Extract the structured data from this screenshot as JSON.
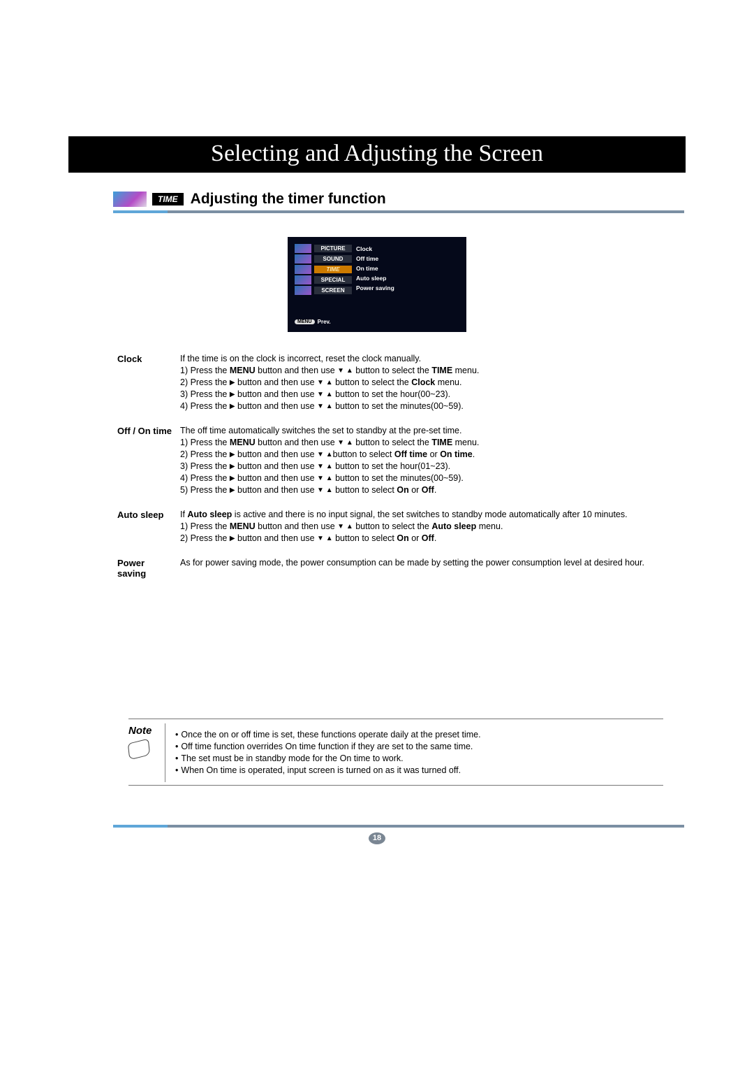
{
  "banner_title": "Selecting and Adjusting the Screen",
  "time_tag": "TIME",
  "subheading": "Adjusting the timer function",
  "osd": {
    "left": [
      "PICTURE",
      "SOUND",
      "TIME",
      "SPECIAL",
      "SCREEN"
    ],
    "right": [
      "Clock",
      "Off time",
      "On time",
      "Auto sleep",
      "Power saving"
    ],
    "menu": "MENU",
    "prev": "Prev."
  },
  "sections": {
    "clock": {
      "label": "Clock",
      "intro": "If the time is on the clock is incorrect, reset the clock manually.",
      "l1a": "1) Press the ",
      "l1b": "MENU",
      "l1c": " button and then use ",
      "l1d": " button to select the ",
      "l1e": "TIME",
      "l1f": " menu.",
      "l2a": "2) Press the ",
      "l2b": " button and then use ",
      "l2c": " button to select the ",
      "l2d": "Clock",
      "l2e": " menu.",
      "l3a": "3) Press the ",
      "l3b": "  button and then use ",
      "l3c": " button to set the hour(00~23).",
      "l4a": "4) Press the ",
      "l4b": "  button and then use ",
      "l4c": " button to set the minutes(00~59)."
    },
    "offon": {
      "label": "Off / On time",
      "intro": "The off time automatically switches the set to standby at the pre-set time.",
      "l1a": "1) Press the ",
      "l1b": "MENU",
      "l1c": " button and then use ",
      "l1d": " button to select the ",
      "l1e": "TIME",
      "l1f": " menu.",
      "l2a": "2) Press the ",
      "l2b": " button and then use ",
      "l2c": "button to select ",
      "l2d": "Off time",
      "l2e": " or ",
      "l2f": "On time",
      "l2g": ".",
      "l3a": "3) Press the ",
      "l3b": " button and then use ",
      "l3c": " button to set the hour(01~23).",
      "l4a": "4) Press the ",
      "l4b": " button and then use ",
      "l4c": " button to set the minutes(00~59).",
      "l5a": "5) Press the ",
      "l5b": " button and then use ",
      "l5c": " button to select ",
      "l5d": "On",
      "l5e": " or ",
      "l5f": "Off",
      "l5g": "."
    },
    "autosleep": {
      "label": "Auto sleep",
      "introa": "If ",
      "introb": "Auto sleep",
      "introc": " is active and there is no input signal, the set switches to standby mode automatically after 10 minutes.",
      "l1a": "1) Press the ",
      "l1b": "MENU",
      "l1c": " button and then use ",
      "l1d": " button to select the ",
      "l1e": "Auto sleep",
      "l1f": " menu.",
      "l2a": "2) Press the ",
      "l2b": "  button and then use ",
      "l2c": " button to select ",
      "l2d": "On",
      "l2e": " or ",
      "l2f": "Off",
      "l2g": "."
    },
    "power": {
      "label1": "Power",
      "label2": "saving",
      "text": "As for power saving mode, the power consumption can be made by setting the power consumption level at desired hour."
    }
  },
  "note": {
    "label": "Note",
    "l1": "Once the on or off time is set, these functions operate daily at the preset time.",
    "l2": "Off time function overrides On time function if they are set to the same time.",
    "l3": "The set must be in standby mode for the On time to work.",
    "l4": "When On time is operated, input screen is turned on as it was turned off."
  },
  "page_number": "18"
}
